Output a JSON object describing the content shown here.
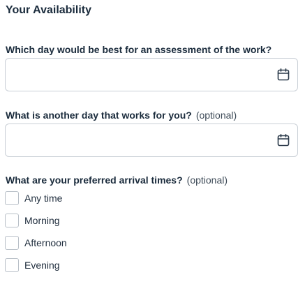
{
  "section": {
    "title": "Your Availability"
  },
  "first_day": {
    "label": "Which day would be best for an assessment of the work?",
    "value": "",
    "icon": "calendar-icon"
  },
  "second_day": {
    "label": "What is another day that works for you?",
    "optional": "(optional)",
    "value": "",
    "icon": "calendar-icon"
  },
  "arrival_times": {
    "label": "What are your preferred arrival times?",
    "optional": "(optional)",
    "options": [
      {
        "label": "Any time",
        "checked": false
      },
      {
        "label": "Morning",
        "checked": false
      },
      {
        "label": "Afternoon",
        "checked": false
      },
      {
        "label": "Evening",
        "checked": false
      }
    ]
  },
  "colors": {
    "text": "#1a2b3c",
    "border": "#c9cfd6",
    "icon": "#2b3a4a"
  }
}
